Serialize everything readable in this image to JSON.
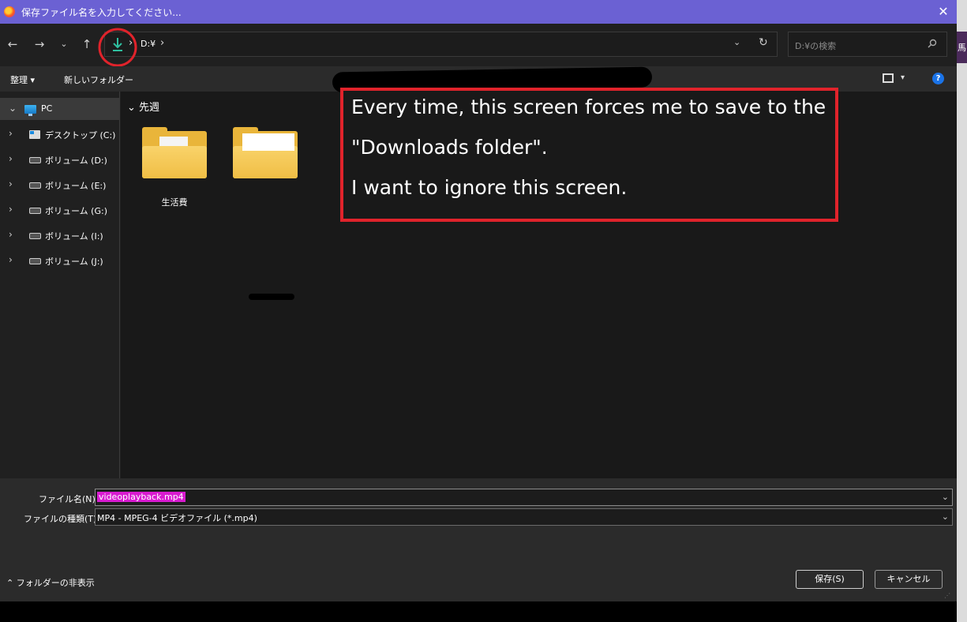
{
  "window": {
    "title": "保存ファイル名を入力してください..."
  },
  "breadcrumb": {
    "drive": "D:¥"
  },
  "search": {
    "placeholder": "D:¥の検索"
  },
  "toolbar": {
    "organize": "整理 ▾",
    "new_folder": "新しいフォルダー"
  },
  "sidebar": {
    "items": [
      {
        "label": "PC"
      },
      {
        "label": "デスクトップ (C:)"
      },
      {
        "label": "ボリューム (D:)"
      },
      {
        "label": "ボリューム (E:)"
      },
      {
        "label": "ボリューム (G:)"
      },
      {
        "label": "ボリューム (I:)"
      },
      {
        "label": "ボリューム (J:)"
      }
    ]
  },
  "content": {
    "group": "先週",
    "folders": [
      {
        "label": "生活費"
      }
    ]
  },
  "annotation": {
    "lines": [
      "Every time, this screen forces me to save to the",
      "\"Downloads folder\".",
      "I want to ignore this screen."
    ]
  },
  "form": {
    "filename_label": "ファイル名(N):",
    "filename_value": "videoplayback.mp4",
    "filetype_label": "ファイルの種類(T):",
    "filetype_value": "MP4 - MPEG-4 ビデオファイル (*.mp4)",
    "hide_folders": "フォルダーの非表示",
    "save": "保存(S)",
    "cancel": "キャンセル"
  },
  "colors": {
    "title_bar": "#6b61d3",
    "annotation_border": "#e0232b",
    "highlight": "#d81bd0",
    "download_icon": "#2fbf9f"
  }
}
